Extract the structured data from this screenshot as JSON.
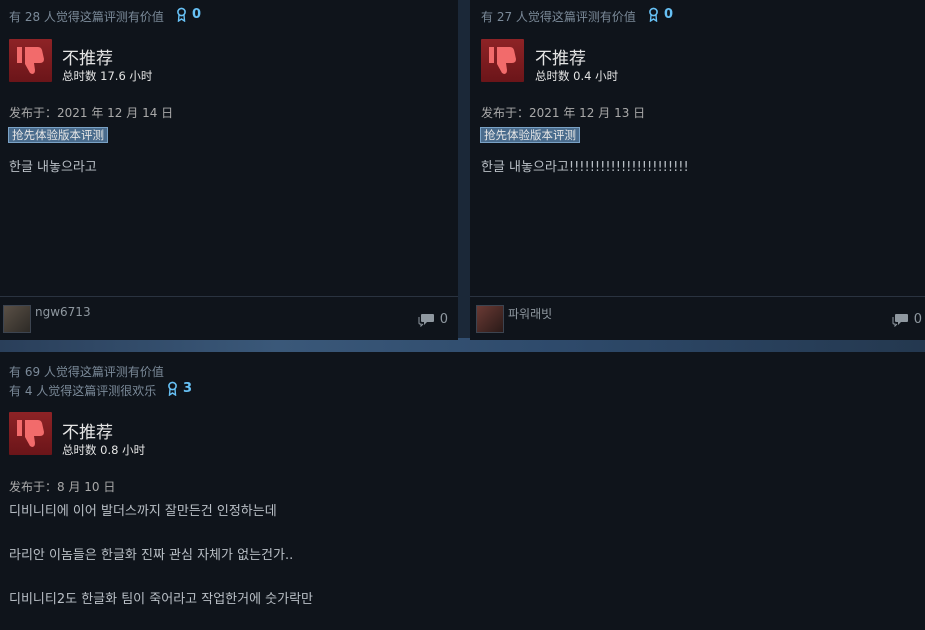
{
  "reviews": [
    {
      "helpful": "有 28 人觉得这篇评测有价值",
      "funny": "",
      "awards": "0",
      "verdict": "不推荐",
      "hours": "总时数 17.6 小时",
      "posted": "发布于：2021 年 12 月 14 日",
      "badge": "抢先体验版本评测",
      "lines": [
        "한글 내놓으라고"
      ],
      "username": "ngw6713",
      "comments": "0"
    },
    {
      "helpful": "有 27 人觉得这篇评测有价值",
      "funny": "",
      "awards": "0",
      "verdict": "不推荐",
      "hours": "总时数 0.4 小时",
      "posted": "发布于：2021 年 12 月 13 日",
      "badge": "抢先体验版本评测",
      "lines": [
        "한글 내놓으라고!!!!!!!!!!!!!!!!!!!!!!!"
      ],
      "username": "파워래빗",
      "comments": "0"
    },
    {
      "helpful": "有 69 人觉得这篇评测有价值",
      "funny": "有 4 人觉得这篇评测很欢乐",
      "awards": "3",
      "verdict": "不推荐",
      "hours": "总时数 0.8 小时",
      "posted": "发布于：8 月 10 日",
      "badge": "",
      "lines": [
        "디비니티에 이어 발더스까지 잘만든건 인정하는데",
        "라리안 이놈들은 한글화 진짜 관심 자체가 없는건가..",
        "디비니티2도 한글화 팀이 죽어라고 작업한거에 숫가락만"
      ],
      "username": "",
      "comments": ""
    }
  ],
  "colors": {
    "card_bg": "#0f141b",
    "award_blue": "#67c1f5",
    "thumb_red": "#8e2326",
    "badge_bg": "#4a6c8d"
  },
  "icons": {
    "award": "award-ribbon-icon",
    "thumb": "thumbs-down-icon",
    "comment": "comment-bubble-icon"
  }
}
